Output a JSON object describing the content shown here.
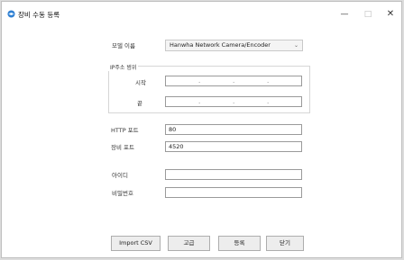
{
  "window": {
    "title": "장비 수동 등록",
    "minimize_glyph": "—",
    "maximize_glyph": "□",
    "close_glyph": "✕"
  },
  "form": {
    "model_label": "모델 이름",
    "model_value": "Hanwha Network Camera/Encoder",
    "ip_range_label": "IP주소 범위",
    "start_label": "시작",
    "end_label": "끝",
    "start_ip": "",
    "end_ip": "",
    "http_port_label": "HTTP 포트",
    "http_port_value": "80",
    "device_port_label": "장비 포트",
    "device_port_value": "4520",
    "id_label": "아이디",
    "id_value": "",
    "password_label": "비밀번호",
    "password_value": ""
  },
  "buttons": {
    "import_csv": "Import CSV",
    "advanced": "고급",
    "register": "등록",
    "close": "닫기"
  },
  "colors": {
    "app_icon": "#2f7fd1"
  }
}
